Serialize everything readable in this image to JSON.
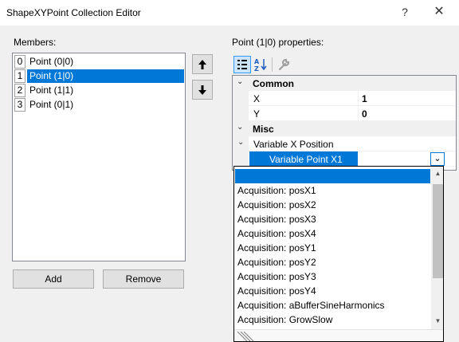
{
  "window": {
    "title": "ShapeXYPoint Collection Editor",
    "help_glyph": "?",
    "close_glyph": "✕"
  },
  "members": {
    "label": "Members:",
    "items": [
      {
        "index": "0",
        "label": "Point (0|0)",
        "selected": false
      },
      {
        "index": "1",
        "label": "Point (1|0)",
        "selected": true
      },
      {
        "index": "2",
        "label": "Point (1|1)",
        "selected": false
      },
      {
        "index": "3",
        "label": "Point (0|1)",
        "selected": false
      }
    ],
    "add_label": "Add",
    "remove_label": "Remove",
    "up_glyph": "🡅",
    "down_glyph": "🡇"
  },
  "properties": {
    "label": "Point (1|0) properties:",
    "toolbar": {
      "categorized_icon": "categorized-icon",
      "alphabetical_icon": "alphabetical-icon",
      "property_pages_icon": "wrench-icon"
    },
    "categories": [
      {
        "name": "Common",
        "rows": [
          {
            "name": "X",
            "value": "1"
          },
          {
            "name": "Y",
            "value": "0"
          }
        ]
      },
      {
        "name": "Misc",
        "rows": [
          {
            "name": "Variable X Position",
            "value": ""
          }
        ]
      }
    ],
    "editing_value": "Variable Point X1",
    "dropdown_items": [
      "",
      "Acquisition: posX1",
      "Acquisition: posX2",
      "Acquisition: posX3",
      "Acquisition: posX4",
      "Acquisition: posY1",
      "Acquisition: posY2",
      "Acquisition: posY3",
      "Acquisition: posY4",
      "Acquisition: aBufferSineHarmonics",
      "Acquisition: GrowSlow"
    ]
  },
  "colors": {
    "selection": "#0078d7",
    "background": "#f0f0f0"
  }
}
